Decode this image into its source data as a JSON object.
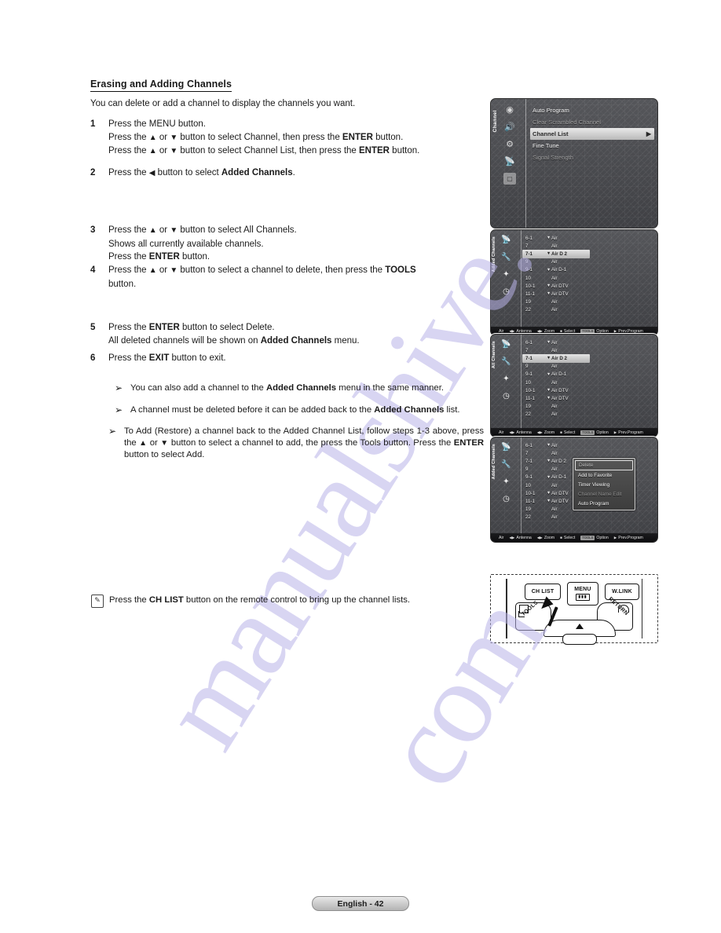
{
  "page": {
    "title": "Erasing and Adding Channels",
    "lead": "You can delete or add a channel to display the channels you want.",
    "footer": "English - 42",
    "watermark_line1": "manualshive.",
    "watermark_line2": "com"
  },
  "steps": [
    {
      "num": "1",
      "lines": [
        "Press the MENU button.",
        "Press the ▲ or ▼ button to select Channel, then press the ENTER button.",
        "Press the ▲ or ▼ button to select Channel List, then press the ENTER button."
      ]
    },
    {
      "num": "2",
      "lines": [
        "Press the ◀ button to select Added Channels."
      ]
    },
    {
      "num": "3",
      "lines": [
        "Press the ▲ or ▼ button to select All Channels.",
        "Shows all currently available channels.",
        "Press the ENTER button."
      ]
    },
    {
      "num": "4",
      "lines": [
        "Press the ▲ or ▼ button to select a channel to delete, then press the TOOLS",
        "button."
      ]
    },
    {
      "num": "5",
      "lines": [
        "Press the ENTER button to select Delete.",
        "All deleted channels will be shown on Added Channels menu."
      ]
    },
    {
      "num": "6",
      "lines": [
        "Press the EXIT button to exit."
      ]
    }
  ],
  "notes": [
    {
      "bullet": "➢",
      "text": "You can also add a channel to the Added Channels menu in the same manner."
    },
    {
      "bullet": "➢",
      "text": "A channel must be deleted before it can be added back to the Added Channels list."
    },
    {
      "bullet": "➢",
      "text": "To Add (Restore) a channel back to the Added Channel List, follow steps 1-3 above, press the ▲ or ▼ button to select a channel to add, the press the Tools button. Press the ENTER button to select Add."
    }
  ],
  "chlist_note": {
    "icon": "note-pencil-icon",
    "text": "Press the CH LIST button on the remote control to bring up the channel lists."
  },
  "panels": {
    "menu": {
      "rail_label": "Channel",
      "rail_icons": [
        "picture-icon",
        "sound-icon",
        "channel-icon",
        "setup-icon",
        "input-icon"
      ],
      "items": [
        {
          "label": "Auto Program",
          "state": "normal"
        },
        {
          "label": "Clear Scrambled Channel",
          "state": "dim"
        },
        {
          "label": "Channel List",
          "state": "selected",
          "arrow": "▶"
        },
        {
          "label": "Fine Tune",
          "state": "normal"
        },
        {
          "label": "Signal Strength",
          "state": "dim"
        }
      ]
    },
    "all_channels_1": {
      "rail_label": "Added Channels",
      "rows": [
        {
          "num": "6-1",
          "lock": "▼",
          "name": "Air"
        },
        {
          "num": "7",
          "lock": "",
          "name": "Air"
        },
        {
          "num": "7-1",
          "lock": "▼",
          "name": "Air D 2",
          "selected": true
        },
        {
          "num": "9",
          "lock": "",
          "name": "Air"
        },
        {
          "num": "9-1",
          "lock": "▼",
          "name": "Air D-1"
        },
        {
          "num": "10",
          "lock": "",
          "name": "Air"
        },
        {
          "num": "10-1",
          "lock": "▼",
          "name": "Air DTV"
        },
        {
          "num": "11-1",
          "lock": "▼",
          "name": "Air DTV"
        },
        {
          "num": "19",
          "lock": "",
          "name": "Air"
        },
        {
          "num": "22",
          "lock": "",
          "name": "Air"
        }
      ],
      "bar": {
        "source": "Air",
        "hints": [
          {
            "key": "◀▶",
            "label": "Antenna"
          },
          {
            "key": "◀▶",
            "label": "Zoom"
          },
          {
            "key": "■",
            "label": "Select"
          },
          {
            "key": "TOOLS",
            "label": "Option",
            "boxed": true
          },
          {
            "key": "▶",
            "label": "Prev.Program"
          }
        ]
      }
    },
    "all_channels_2": {
      "rail_label": "All Channels",
      "rows": [
        {
          "num": "6-1",
          "lock": "▼",
          "name": "Air"
        },
        {
          "num": "7",
          "lock": "",
          "name": "Air"
        },
        {
          "num": "7-1",
          "lock": "▼",
          "name": "Air D 2",
          "selected": true
        },
        {
          "num": "9",
          "lock": "",
          "name": "Air"
        },
        {
          "num": "9-1",
          "lock": "▼",
          "name": "Air D-1"
        },
        {
          "num": "10",
          "lock": "",
          "name": "Air"
        },
        {
          "num": "10-1",
          "lock": "▼",
          "name": "Air DTV"
        },
        {
          "num": "11-1",
          "lock": "▼",
          "name": "Air DTV"
        },
        {
          "num": "19",
          "lock": "",
          "name": "Air"
        },
        {
          "num": "22",
          "lock": "",
          "name": "Air"
        }
      ],
      "bar": {
        "source": "Air",
        "hints": [
          {
            "key": "◀▶",
            "label": "Antenna"
          },
          {
            "key": "◀▶",
            "label": "Zoom"
          },
          {
            "key": "■",
            "label": "Select"
          },
          {
            "key": "TOOLS",
            "label": "Option",
            "boxed": true
          },
          {
            "key": "▶",
            "label": "Prev.Program"
          }
        ]
      }
    },
    "tools": {
      "rail_label": "Added Channels",
      "rows": [
        {
          "num": "6-1",
          "lock": "▼",
          "name": "Air"
        },
        {
          "num": "7",
          "lock": "",
          "name": "Air"
        },
        {
          "num": "7-1",
          "lock": "▼",
          "name": "Air D 2"
        },
        {
          "num": "9",
          "lock": "",
          "name": "Air"
        },
        {
          "num": "9-1",
          "lock": "▼",
          "name": "Air D-1"
        },
        {
          "num": "10",
          "lock": "",
          "name": "Air"
        },
        {
          "num": "10-1",
          "lock": "▼",
          "name": "Air DTV"
        },
        {
          "num": "11-1",
          "lock": "▼",
          "name": "Air DTV"
        },
        {
          "num": "19",
          "lock": "",
          "name": "Air"
        },
        {
          "num": "22",
          "lock": "",
          "name": "Air"
        }
      ],
      "popup": [
        {
          "label": "Delete",
          "state": "selected"
        },
        {
          "label": "Add to Favorite",
          "state": "normal"
        },
        {
          "label": "Timer Viewing",
          "state": "normal"
        },
        {
          "label": "Channel Name Edit",
          "state": "dim"
        },
        {
          "label": "Auto Program",
          "state": "normal"
        }
      ],
      "bar": {
        "source": "Air",
        "hints": [
          {
            "key": "◀▶",
            "label": "Antenna"
          },
          {
            "key": "◀▶",
            "label": "Zoom"
          },
          {
            "key": "■",
            "label": "Select"
          },
          {
            "key": "TOOLS",
            "label": "Option",
            "boxed": true
          },
          {
            "key": "▶",
            "label": "Prev.Program"
          }
        ]
      }
    }
  },
  "remote": {
    "ch_list": "CH LIST",
    "menu": "MENU",
    "menu_glyph": "▮▮▮",
    "wlink": "W.LINK",
    "tools": "TOOLS",
    "return": "RETURN"
  }
}
